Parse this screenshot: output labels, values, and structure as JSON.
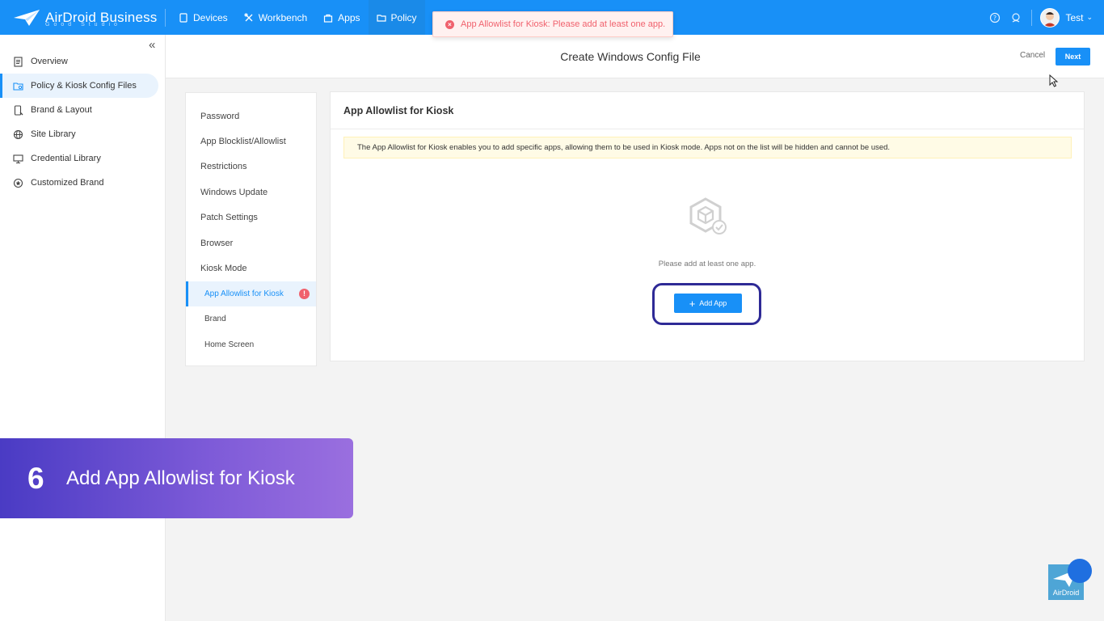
{
  "topbar": {
    "logo_text": "AirDroid Business",
    "logo_sub": "Good Studio",
    "nav": [
      {
        "label": "Devices",
        "icon": "tablet-icon"
      },
      {
        "label": "Workbench",
        "icon": "tools-icon"
      },
      {
        "label": "Apps",
        "icon": "bag-icon"
      },
      {
        "label": "Policy",
        "icon": "folder-icon",
        "active": true
      }
    ],
    "user": "Test"
  },
  "toast": {
    "message": "App Allowlist for Kiosk: Please add at least one app."
  },
  "sidebar": {
    "items": [
      {
        "label": "Overview",
        "icon": "document-icon"
      },
      {
        "label": "Policy & Kiosk Config Files",
        "icon": "folder-settings-icon",
        "active": true
      },
      {
        "label": "Brand & Layout",
        "icon": "phone-brush-icon"
      },
      {
        "label": "Site Library",
        "icon": "globe-icon"
      },
      {
        "label": "Credential Library",
        "icon": "monitor-icon"
      },
      {
        "label": "Customized Brand",
        "icon": "star-circle-icon"
      }
    ]
  },
  "header": {
    "title": "Create Windows Config File",
    "cancel": "Cancel",
    "next": "Next"
  },
  "menu": {
    "items": [
      {
        "label": "Password"
      },
      {
        "label": "App Blocklist/Allowlist"
      },
      {
        "label": "Restrictions"
      },
      {
        "label": "Windows Update"
      },
      {
        "label": "Patch Settings"
      },
      {
        "label": "Browser"
      },
      {
        "label": "Kiosk Mode"
      },
      {
        "label": "App Allowlist for Kiosk",
        "sub": true,
        "active": true,
        "error": "!"
      },
      {
        "label": "Brand",
        "sub": true
      },
      {
        "label": "Home Screen",
        "sub": true
      }
    ]
  },
  "content": {
    "title": "App Allowlist for Kiosk",
    "notice": "The App Allowlist for Kiosk enables you to add specific apps, allowing them to be used in Kiosk mode. Apps not on the list will be hidden and cannot be used.",
    "empty_text": "Please add at least one app.",
    "add_button": "Add App"
  },
  "banner": {
    "number": "6",
    "text": "Add App Allowlist for Kiosk"
  },
  "watermark": {
    "text": "AirDroid"
  },
  "colors": {
    "primary": "#1890f7",
    "error": "#f0616d",
    "banner_start": "#4a3bc4",
    "banner_end": "#9a6fdf"
  }
}
